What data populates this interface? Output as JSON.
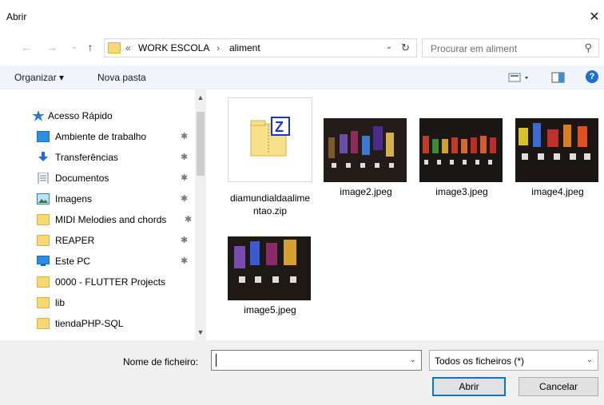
{
  "window": {
    "title": "Abrir",
    "close_glyph": "✕"
  },
  "nav": {
    "back_glyph": "←",
    "forward_glyph": "→",
    "recent_glyph": "⌄",
    "up_glyph": "↑",
    "breadcrumb_overflow": "«",
    "breadcrumb": [
      "WORK ESCOLA",
      "aliment"
    ],
    "breadcrumb_sep": "›",
    "refresh_glyph": "↻",
    "search_placeholder": "Procurar em aliment"
  },
  "toolbar": {
    "organize_label": "Organizar ▾",
    "new_folder_label": "Nova pasta",
    "help_glyph": "?"
  },
  "sidebar": {
    "items": [
      {
        "label": "Acesso Rápido",
        "icon": "star-icon",
        "pinned": false
      },
      {
        "label": "Ambiente de trabalho",
        "icon": "desktop-icon",
        "pinned": true
      },
      {
        "label": "Transferências",
        "icon": "download-icon",
        "pinned": true
      },
      {
        "label": "Documentos",
        "icon": "document-icon",
        "pinned": true
      },
      {
        "label": "Imagens",
        "icon": "pictures-icon",
        "pinned": true
      },
      {
        "label": "MIDI Melodies and chords",
        "icon": "folder-icon",
        "pinned": true
      },
      {
        "label": "REAPER",
        "icon": "folder-icon",
        "pinned": true
      },
      {
        "label": "Este PC",
        "icon": "computer-icon",
        "pinned": true
      },
      {
        "label": "0000 - FLUTTER Projects",
        "icon": "folder-icon",
        "pinned": false
      },
      {
        "label": "lib",
        "icon": "folder-icon",
        "pinned": false
      },
      {
        "label": "tiendaPHP-SQL",
        "icon": "folder-icon",
        "pinned": false
      }
    ],
    "pin_glyph": "📌"
  },
  "files": [
    {
      "name": "diamundialdaalimentao.zip",
      "kind": "zip"
    },
    {
      "name": "image2.jpeg",
      "kind": "image"
    },
    {
      "name": "image3.jpeg",
      "kind": "image"
    },
    {
      "name": "image4.jpeg",
      "kind": "image"
    },
    {
      "name": "image5.jpeg",
      "kind": "image"
    }
  ],
  "bottom": {
    "filename_label": "Nome de ficheiro:",
    "filename_value": "",
    "filetype_value": "Todos os ficheiros (*)",
    "open_label": "Abrir",
    "cancel_label": "Cancelar"
  },
  "colors": {
    "accent": "#0078d7",
    "folder": "#f8d775",
    "toolbar_bg": "#f0f5fb"
  }
}
